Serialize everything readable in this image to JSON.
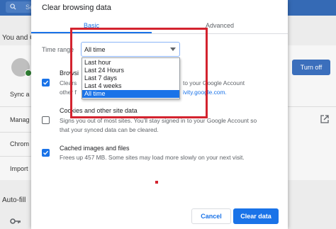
{
  "background": {
    "search_placeholder": "Se",
    "section_heading": "You and G",
    "items": [
      "Sync a",
      "Manag",
      "Chrom",
      "Import"
    ],
    "turn_off_label": "Turn off",
    "autofill_heading": "Auto-fill",
    "topbar_color": "#356ab5"
  },
  "dialog": {
    "title": "Clear browsing data",
    "tabs": [
      {
        "label": "Basic",
        "active": true
      },
      {
        "label": "Advanced",
        "active": false
      }
    ],
    "time_range": {
      "label": "Time range",
      "selected": "All time",
      "options": [
        "Last hour",
        "Last 24 Hours",
        "Last 7 days",
        "Last 4 weeks",
        "All time"
      ]
    },
    "items": [
      {
        "checked": true,
        "title": "Browsi",
        "desc_line1_start": "Clears",
        "desc_line1_end": "to your Google Account",
        "desc_line2_start": "other f",
        "desc_line2_link": "ivity.google.com."
      },
      {
        "checked": false,
        "title": "Cookies and other site data",
        "desc_line1": "Signs you out of most sites. You'll stay signed in to your Google Account so",
        "desc_line2": "that your synced data can be cleared."
      },
      {
        "checked": true,
        "title": "Cached images and files",
        "desc_line1": "Frees up 457 MB. Some sites may load more slowly on your next visit."
      }
    ],
    "cancel_label": "Cancel",
    "clear_label": "Clear data",
    "accent_color": "#1a73e8",
    "annotation_color": "#d3232f"
  }
}
